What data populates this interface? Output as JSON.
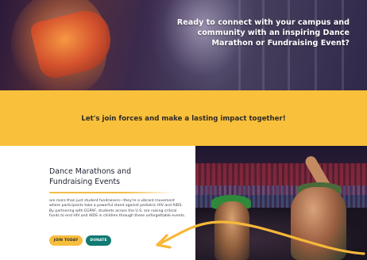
{
  "hero": {
    "line1": "Ready to connect with your campus and",
    "line2": "community with an inspiring Dance",
    "line3": "Marathon or Fundraising Event?"
  },
  "band": {
    "tagline": "Let's join forces and make a lasting impact together!"
  },
  "events": {
    "title_line1": "Dance Marathons and",
    "title_line2": "Fundraising Events",
    "body": "are more than just student fundraisers—they're a vibrant movement where participants take a powerful stand against pediatric HIV and AIDS. By partnering with EGPAF, students across the U.S. are raising critical funds to end HIV and AIDS in children through these unforgettable events.",
    "join_label": "JOIN TODAY",
    "donate_label": "DONATE"
  },
  "colors": {
    "accent_yellow": "#f9c13b",
    "donate_teal": "#0f7a72",
    "arrow_yellow": "#f6b83a"
  }
}
